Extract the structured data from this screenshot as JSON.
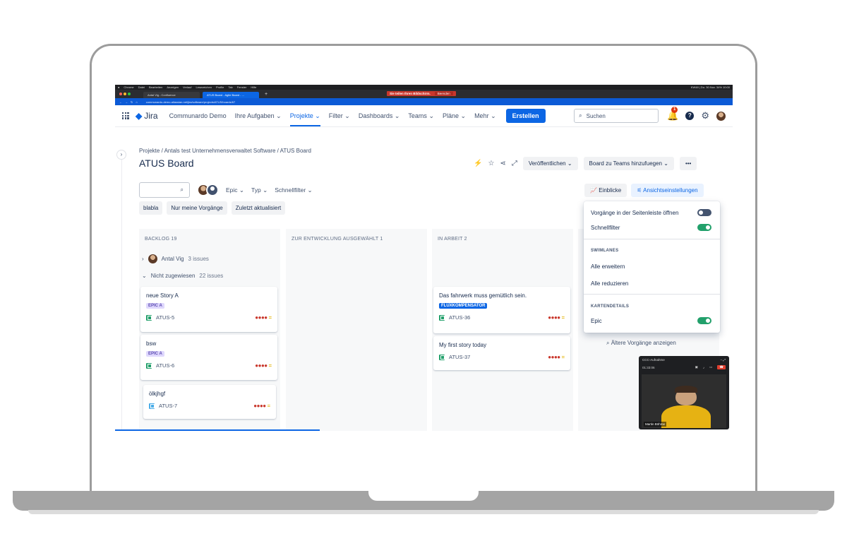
{
  "macbar": {
    "left": [
      "Chrome",
      "Datei",
      "Bearbeiten",
      "Anzeigen",
      "Verlauf",
      "Lesezeichen",
      "Profile",
      "Tab",
      "Fenster",
      "Hilfe"
    ],
    "right": "KW48 | Do. 30.Nov. 34% 10:00"
  },
  "share_banner": {
    "text": "Sie teilen Ihren Bildschirm.",
    "button": "Beenden"
  },
  "browser": {
    "tabs": [
      "Antal Vig - Confluence",
      "ATUS Board - Agile Board - ..."
    ],
    "url": "communardo-demo.atlassian.net/jira/software/projects/ATUS/boards/67"
  },
  "header": {
    "logo": "Jira",
    "nav": [
      "Communardo Demo",
      "Ihre Aufgaben",
      "Projekte",
      "Filter",
      "Dashboards",
      "Teams",
      "Pläne",
      "Mehr"
    ],
    "create": "Erstellen",
    "search_placeholder": "Suchen",
    "notif_count": "1"
  },
  "breadcrumb": "Projekte  /  Antals test Unternehmensverwaltet Software  /  ATUS Board",
  "title": "ATUS Board",
  "toolbar": {
    "publish": "Veröffentlichen",
    "add_to_teams": "Board zu Teams hinzufuegen",
    "more": "•••"
  },
  "filters": {
    "epic": "Epic",
    "typ": "Typ",
    "quick": "Schnellfilter",
    "chips": [
      "blabla",
      "Nur meine Vorgänge",
      "Zuletzt aktualisiert"
    ]
  },
  "view_buttons": {
    "insights": "Einblicke",
    "settings": "Ansichtseinstellungen"
  },
  "columns": [
    "BACKLOG 19",
    "ZUR ENTWICKLUNG AUSGEWÄHLT 1",
    "IN ARBEIT 2"
  ],
  "swimlanes": {
    "antal": {
      "name": "Antal Vig",
      "count": "3 issues"
    },
    "unassigned": {
      "name": "Nicht zugewiesen",
      "count": "22 issues"
    }
  },
  "cards": [
    {
      "title": "neue Story A",
      "epic": "EPIC A",
      "key": "ATUS-5"
    },
    {
      "title": "bsw",
      "epic": "EPIC A",
      "key": "ATUS-6"
    },
    {
      "title": "ölkjhgf",
      "key": "ATUS-7"
    },
    {
      "title": "Das fahrwerk muss gemütlich sein.",
      "epic": "FLUXKOMPENSATOR",
      "key": "ATUS-36"
    },
    {
      "title": "My first story today",
      "key": "ATUS-37"
    }
  ],
  "menu": {
    "open_sidebar": "Vorgänge in der Seitenleiste öffnen",
    "quickfilter": "Schnellfilter",
    "swimlanes_heading": "SWIMLANES",
    "expand_all": "Alle erweitern",
    "collapse_all": "Alle reduzieren",
    "card_details_heading": "KARTENDETAILS",
    "epic": "Epic"
  },
  "older": "Ältere Vorgänge anzeigen",
  "recorder": {
    "title": "CCC-Aufnahme",
    "time": "01:33:06",
    "name": "Martin Böhme"
  },
  "colors": {
    "accent": "#0c66e4",
    "toggle_on": "#22a06b",
    "priority": "#c9372c"
  }
}
